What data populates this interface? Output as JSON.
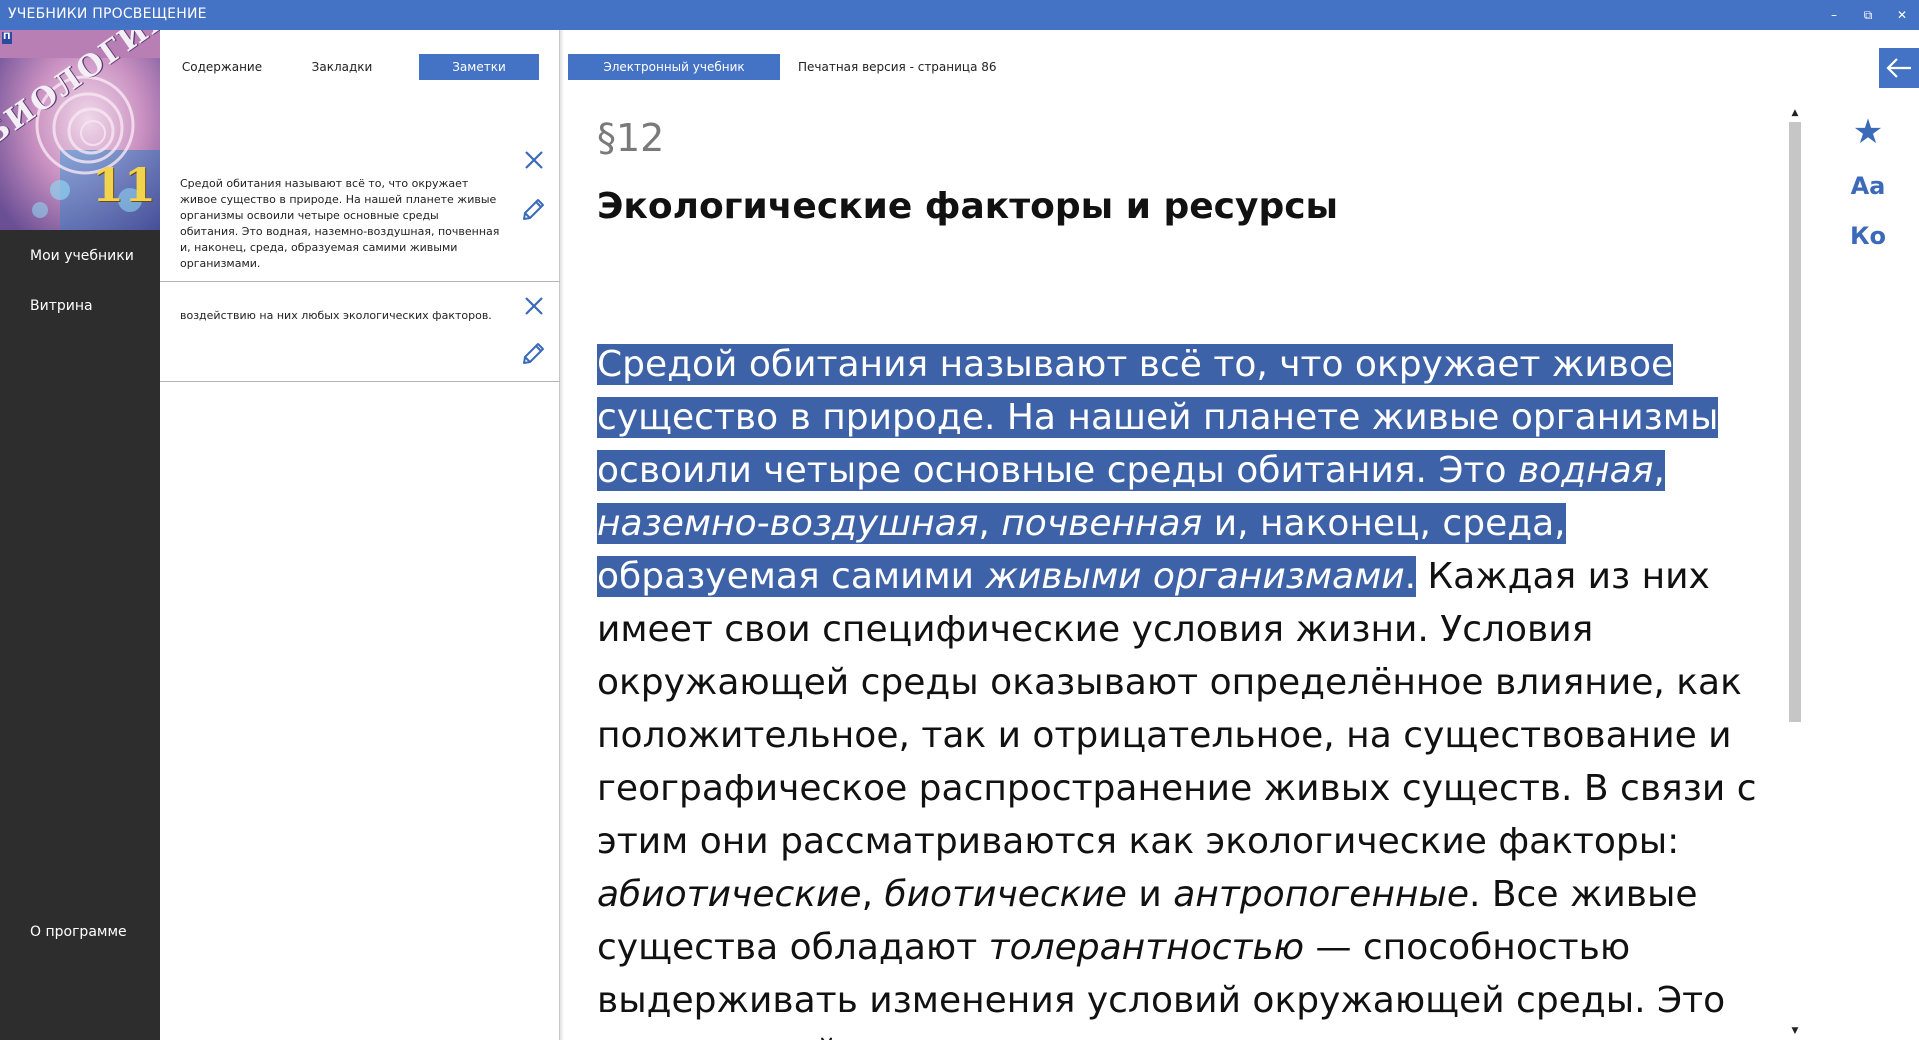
{
  "window": {
    "title": "УЧЕБНИКИ ПРОСВЕЩЕНИЕ",
    "controls": {
      "minimize": "–",
      "restore": "⧉",
      "close": "✕"
    }
  },
  "cover": {
    "subject": "БИОЛОГИЯ",
    "grade": "11",
    "publisher_mark": "П"
  },
  "sidebar": {
    "items": [
      {
        "label": "Мои учебники"
      },
      {
        "label": "Витрина"
      }
    ],
    "about": "О программе"
  },
  "panel_tabs": [
    {
      "label": "Содержание",
      "active": false
    },
    {
      "label": "Закладки",
      "active": false
    },
    {
      "label": "Заметки",
      "active": true
    }
  ],
  "notes": [
    {
      "text": "Средой обитания называют всё то, что окружает живое существо в природе. На нашей планете живые организмы освоили четыре основные среды обитания. Это водная, наземно-воздушная, почвенная и, наконец, среда, образуемая самими живыми организмами."
    },
    {
      "text": "воздействию на них любых экологических факторов."
    }
  ],
  "reader": {
    "mode_tab": "Электронный учебник",
    "print_page": "Печатная версия - страница 86",
    "paragraph_number": "§12",
    "title": "Экологические факторы и ресурсы",
    "body": {
      "hl_1": "Средой обитания называют всё то, что окружает живое существо в природе. На нашей планете живые организмы освоили четыре основные среды обитания. Это ",
      "hl_i1": "водная",
      "hl_2": ", ",
      "hl_i2": "наземно-воздушная",
      "hl_3": ", ",
      "hl_i3": "почвенная",
      "hl_4": " и, наконец, среда, образуемая самими ",
      "hl_i4": "живыми организмами",
      "hl_5": ".",
      "t1": " Каждая из них имеет свои специфические условия жизни. Условия окружающей среды оказывают определённое влияние, как положительное, так и отрицательное, на существование и географическое распространение живых существ. В связи с этим они рассматриваются как экологические факторы: ",
      "i1": "абиотические",
      "t2": ", ",
      "i2": "биотические",
      "t3": " и ",
      "i3": "антропогенные",
      "t4": ". Все живые существа обладают ",
      "i4": "толерантностью",
      "t5": " — способностью выдерживать изменения условий окружающей среды. Это важное свойство позволяет"
    }
  },
  "right_toolbar": {
    "bookmark_icon": "★",
    "font_label": "Аа",
    "contents_label": "Ко"
  },
  "colors": {
    "accent": "#4472c4",
    "highlight": "#3d62a8",
    "sidebar_bg": "#2d2d2d"
  }
}
